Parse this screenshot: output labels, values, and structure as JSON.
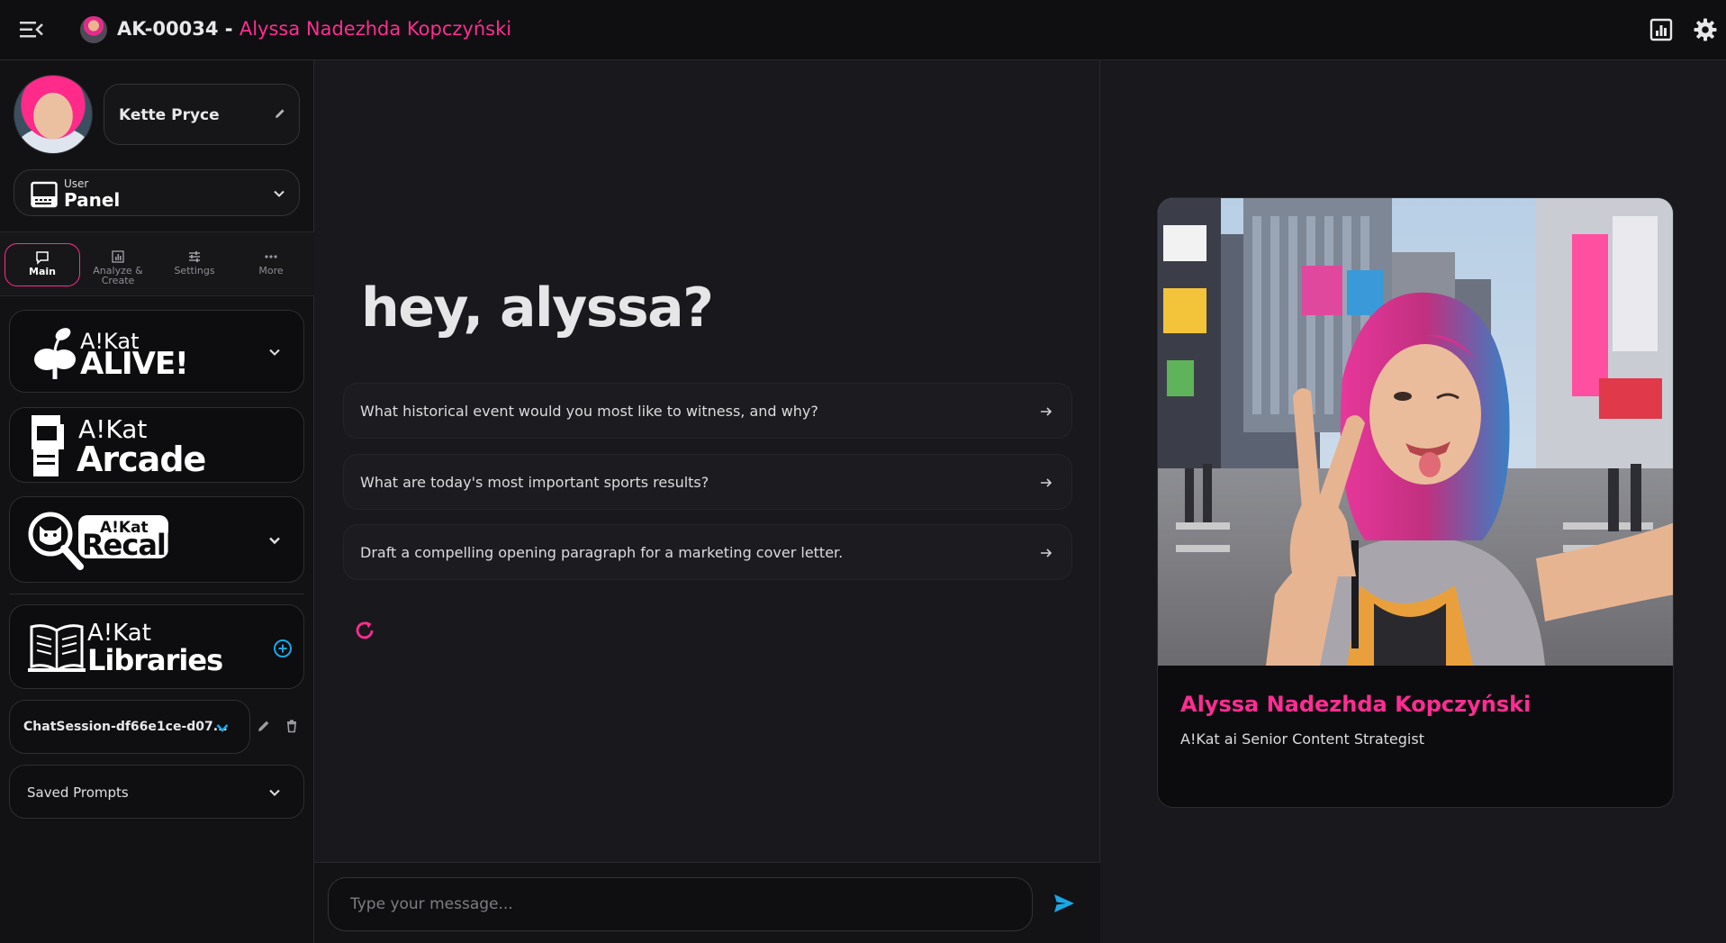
{
  "header": {
    "id_code": "AK-00034",
    "separator": " - ",
    "persona_name": "Alyssa Nadezhda Kopczyński"
  },
  "sidebar": {
    "user_name": "Kette Pryce",
    "panel_small": "User",
    "panel_big": "Panel",
    "tabs": [
      {
        "label": "Main"
      },
      {
        "label": "Analyze &",
        "label2": "Create"
      },
      {
        "label": "Settings"
      },
      {
        "label": "More"
      }
    ],
    "modules": {
      "alive_small": "A!Kat",
      "alive_big": "ALIVE!",
      "arcade_small": "A!Kat",
      "arcade_big": "Arcade",
      "recall_small": "A!Kat",
      "recall_big": "Recall",
      "libraries_small": "A!Kat",
      "libraries_big": "Libraries"
    },
    "session_label": "ChatSession-df66e1ce-d07...",
    "saved_prompts": "Saved Prompts"
  },
  "chat": {
    "greeting": "hey, alyssa?",
    "suggestions": [
      "What historical event would you most like to witness, and why?",
      "What are today's most important sports results?",
      "Draft a compelling opening paragraph for a marketing cover letter."
    ],
    "input_placeholder": "Type your message..."
  },
  "card": {
    "name": "Alyssa Nadezhda Kopczyński",
    "role": "A!Kat ai Senior Content Strategist"
  },
  "colors": {
    "accent_pink": "#ff2d92",
    "accent_blue": "#1aa7e8",
    "background": "#19181c"
  },
  "icons": [
    "menu-collapse-icon",
    "report-icon",
    "gear-icon",
    "pencil-icon",
    "chevron-down-icon",
    "chat-bubble-icon",
    "chart-icon",
    "sliders-icon",
    "ellipsis-icon",
    "plus-circle-icon",
    "trash-icon",
    "arrow-right-icon",
    "refresh-icon",
    "send-icon"
  ]
}
